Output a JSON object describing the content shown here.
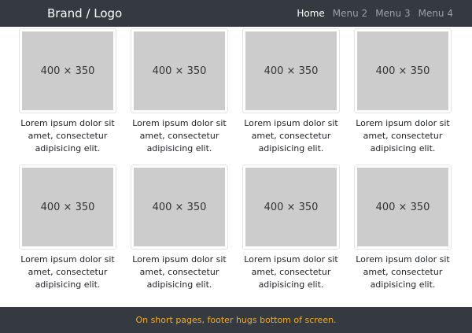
{
  "navbar": {
    "brand": "Brand / Logo",
    "items": [
      {
        "label": "Home",
        "active": true
      },
      {
        "label": "Menu 2",
        "active": false
      },
      {
        "label": "Menu 3",
        "active": false
      },
      {
        "label": "Menu 4",
        "active": false
      }
    ]
  },
  "cards": [
    {
      "image_label": "400 × 350",
      "caption": "Lorem ipsum dolor sit amet, consectetur adipisicing elit."
    },
    {
      "image_label": "400 × 350",
      "caption": "Lorem ipsum dolor sit amet, consectetur adipisicing elit."
    },
    {
      "image_label": "400 × 350",
      "caption": "Lorem ipsum dolor sit amet, consectetur adipisicing elit."
    },
    {
      "image_label": "400 × 350",
      "caption": "Lorem ipsum dolor sit amet, consectetur adipisicing elit."
    },
    {
      "image_label": "400 × 350",
      "caption": "Lorem ipsum dolor sit amet, consectetur adipisicing elit."
    },
    {
      "image_label": "400 × 350",
      "caption": "Lorem ipsum dolor sit amet, consectetur adipisicing elit."
    },
    {
      "image_label": "400 × 350",
      "caption": "Lorem ipsum dolor sit amet, consectetur adipisicing elit."
    },
    {
      "image_label": "400 × 350",
      "caption": "Lorem ipsum dolor sit amet, consectetur adipisicing elit."
    }
  ],
  "footer": {
    "text": "On short pages, footer hugs bottom of screen."
  },
  "colors": {
    "navbar_bg": "#343a40",
    "placeholder_bg": "#cccccc",
    "footer_text": "#f0ad2e"
  }
}
